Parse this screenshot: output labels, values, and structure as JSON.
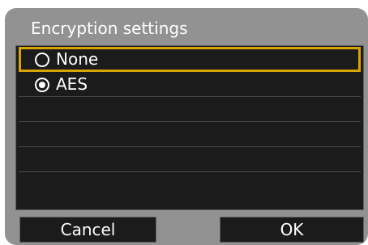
{
  "dialog": {
    "title": "Encryption settings"
  },
  "options": [
    {
      "label": "None",
      "selected_row": true,
      "checked": false
    },
    {
      "label": "AES",
      "selected_row": false,
      "checked": true
    }
  ],
  "buttons": {
    "cancel_label": "Cancel",
    "ok_label": "OK"
  },
  "colors": {
    "frame": "#929292",
    "panel": "#1b1b1b",
    "highlight": "#d8a400",
    "text": "#ffffff"
  }
}
